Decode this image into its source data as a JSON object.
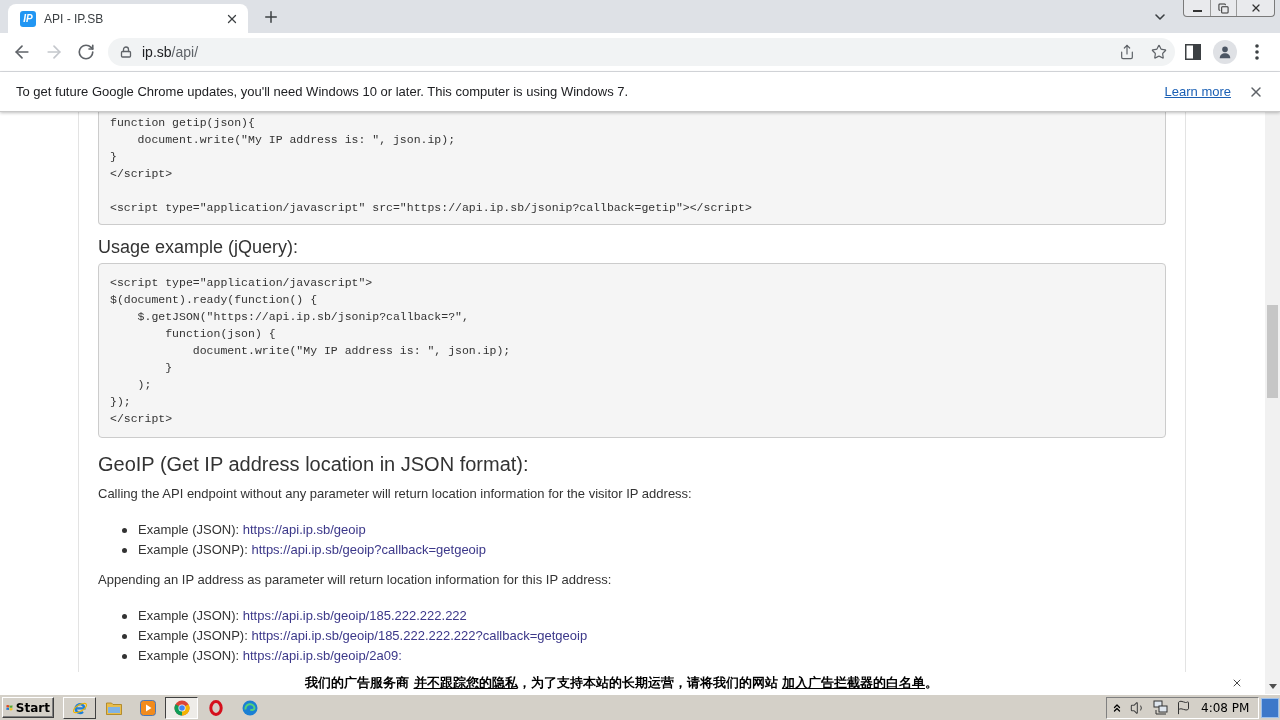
{
  "browser": {
    "tabs": [
      {
        "title": "API - IP.SB",
        "favicon": "IP",
        "selected": true
      }
    ],
    "forward_disabled": true,
    "address_bar": {
      "host": "ip.sb",
      "path": "/api/"
    }
  },
  "infobar": {
    "message": "To get future Google Chrome updates, you'll need Windows 10 or later. This computer is using Windows 7.",
    "link": "Learn more"
  },
  "page": {
    "blocks": [
      {
        "kind": "code",
        "clipped_top": true,
        "code": "function getip(json){\n    document.write(\"My IP address is: \", json.ip);\n}\n</script>\n\n<script type=\"application/javascript\" src=\"https://api.ip.sb/jsonip?callback=getip\"></script>"
      },
      {
        "kind": "subheading",
        "text": "Usage example (jQuery):"
      },
      {
        "kind": "code",
        "clipped_top": false,
        "code": "<script type=\"application/javascript\">\n$(document).ready(function() {\n    $.getJSON(\"https://api.ip.sb/jsonip?callback=?\",\n        function(json) {\n            document.write(\"My IP address is: \", json.ip);\n        }\n    );\n});\n</script>"
      },
      {
        "kind": "heading",
        "text": "GeoIP (Get IP address location in JSON format):"
      },
      {
        "kind": "paragraph",
        "text": "Calling the API endpoint without any parameter will return location information for the visitor IP address:"
      },
      {
        "kind": "list",
        "items": [
          {
            "label": "Example (JSON):",
            "link": "https://api.ip.sb/geoip"
          },
          {
            "label": "Example (JSONP):",
            "link": "https://api.ip.sb/geoip?callback=getgeoip"
          }
        ]
      },
      {
        "kind": "paragraph",
        "text": "Appending an IP address as parameter will return location information for this IP address:"
      },
      {
        "kind": "list",
        "items": [
          {
            "label": "Example (JSON):",
            "link": "https://api.ip.sb/geoip/185.222.222.222"
          },
          {
            "label": "Example (JSONP):",
            "link": "https://api.ip.sb/geoip/185.222.222.222?callback=getgeoip"
          },
          {
            "label": "Example (JSON):",
            "link": "https://api.ip.sb/geoip/2a09:"
          }
        ]
      }
    ]
  },
  "ad_banner": {
    "parts": [
      {
        "kind": "text",
        "text": "我们的广告服务商 "
      },
      {
        "kind": "link",
        "text": "并不跟踪您的隐私"
      },
      {
        "kind": "text",
        "text": "，为了支持本站的长期运营，请将我们的网站 "
      },
      {
        "kind": "link",
        "text": "加入广告拦截器的白名单"
      },
      {
        "kind": "text",
        "text": "。"
      }
    ]
  },
  "taskbar": {
    "start": "Start",
    "items": [
      {
        "kind": "ie",
        "running": true,
        "selected": false
      },
      {
        "kind": "folder",
        "running": false,
        "selected": false
      },
      {
        "kind": "media",
        "running": false,
        "selected": false
      },
      {
        "kind": "chrome",
        "running": true,
        "selected": true
      },
      {
        "kind": "opera",
        "running": false,
        "selected": false
      },
      {
        "kind": "edge",
        "running": false,
        "selected": false
      }
    ],
    "clock": "4:08 PM"
  }
}
